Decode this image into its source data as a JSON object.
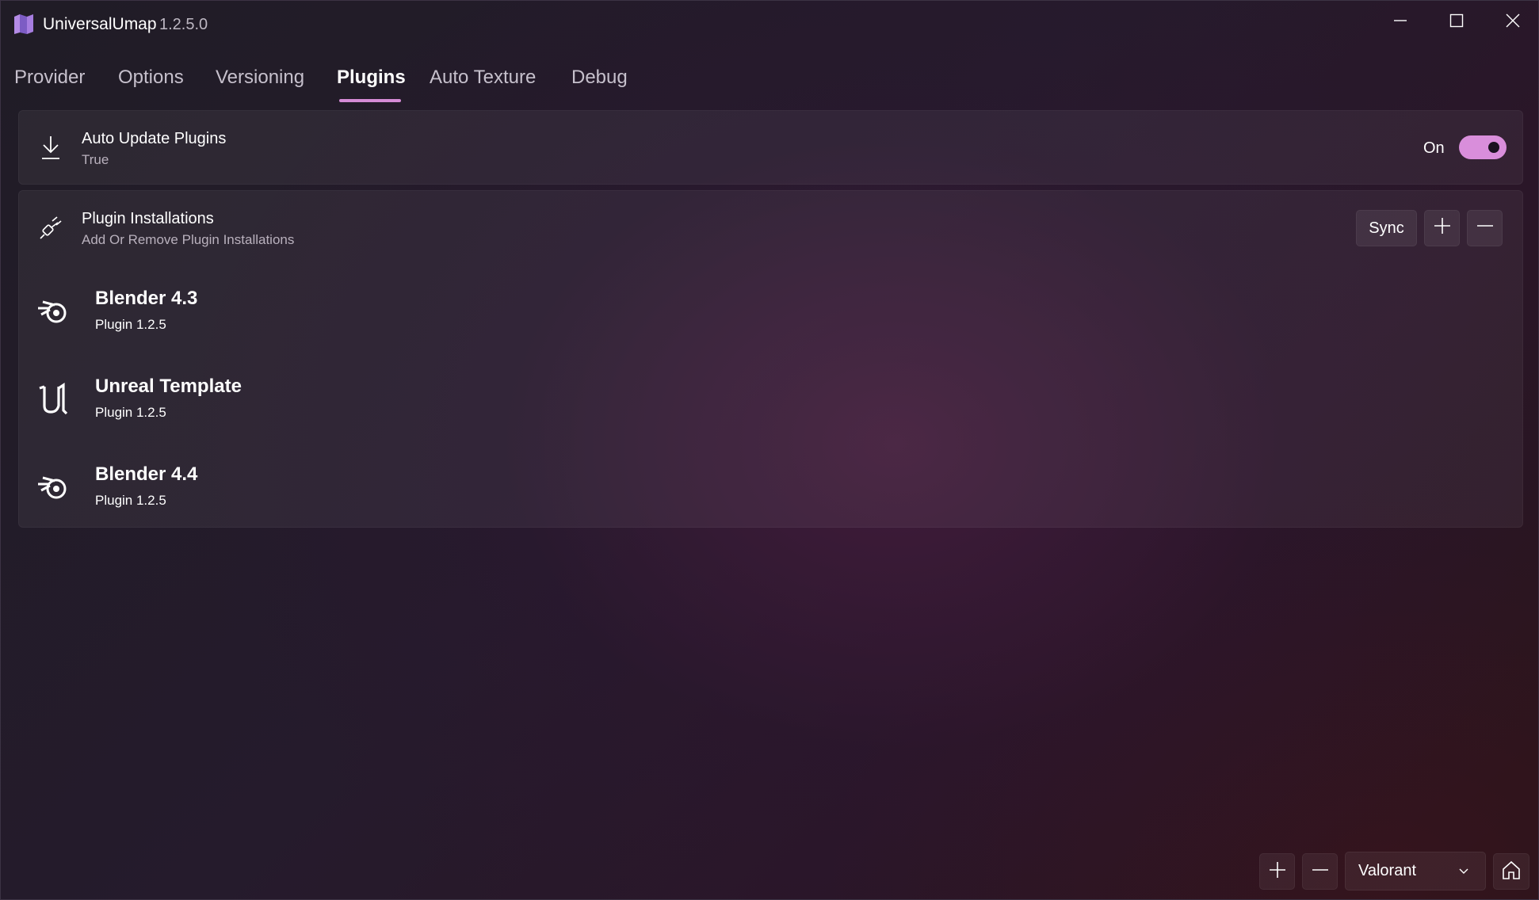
{
  "window": {
    "title": "UniversalUmap",
    "version": "1.2.5.0",
    "controls": [
      "minimize-icon",
      "maximize-icon",
      "close-icon"
    ]
  },
  "tabs": [
    {
      "label": "Provider",
      "active": false
    },
    {
      "label": "Options",
      "active": false
    },
    {
      "label": "Versioning",
      "active": false
    },
    {
      "label": "Plugins",
      "active": true
    },
    {
      "label": "Auto Texture",
      "active": false
    },
    {
      "label": "Debug",
      "active": false
    }
  ],
  "auto_update": {
    "icon": "download-icon",
    "title": "Auto Update Plugins",
    "subtitle": "True",
    "toggle_label": "On",
    "toggle_on": true
  },
  "plugin_installations": {
    "icon": "plug-icon",
    "title": "Plugin Installations",
    "subtitle": "Add Or Remove Plugin Installations",
    "sync_label": "Sync",
    "items": [
      {
        "icon": "blender-icon",
        "name": "Blender 4.3",
        "version": "Plugin 1.2.5"
      },
      {
        "icon": "unreal-icon",
        "name": "Unreal Template",
        "version": "Plugin 1.2.5"
      },
      {
        "icon": "blender-icon",
        "name": "Blender 4.4",
        "version": "Plugin 1.2.5"
      }
    ]
  },
  "footer": {
    "game_select_value": "Valorant",
    "icons": [
      "plus-icon",
      "minus-icon",
      "chevron-down-icon",
      "home-icon"
    ]
  },
  "colors": {
    "accent": "#d58bd6",
    "toggle": "#d98edb"
  }
}
